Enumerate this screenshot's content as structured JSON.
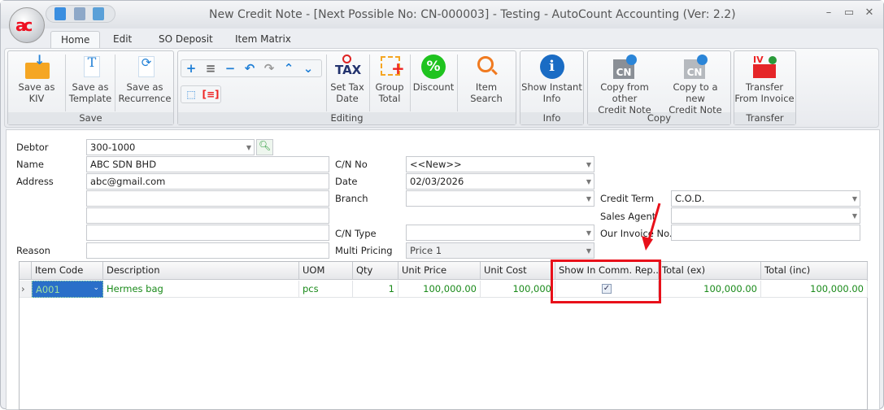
{
  "window": {
    "title": "New Credit Note - [Next Possible No: CN-000003] - Testing - AutoCount Accounting (Ver: 2.2)",
    "logo_text": "ac",
    "controls": [
      "–",
      "▭",
      "✕"
    ]
  },
  "tabs": [
    {
      "label": "Home",
      "active": true
    },
    {
      "label": "Edit"
    },
    {
      "label": "SO Deposit"
    },
    {
      "label": "Item Matrix"
    }
  ],
  "ribbon": {
    "groups": {
      "save": "Save",
      "editing": "Editing",
      "info": "Info",
      "copy": "Copy",
      "transfer": "Transfer"
    },
    "buttons": {
      "save_kiv": [
        "Save as KIV",
        ""
      ],
      "save_template": [
        "Save as",
        "Template"
      ],
      "save_recurrence": [
        "Save as",
        "Recurrence"
      ],
      "set_tax_date": [
        "Set Tax",
        "Date"
      ],
      "group_total": [
        "Group",
        "Total"
      ],
      "discount": [
        "Discount",
        ""
      ],
      "item_search": [
        "Item Search",
        ""
      ],
      "show_instant_info": [
        "Show Instant",
        "Info"
      ],
      "copy_from": [
        "Copy from other",
        "Credit Note"
      ],
      "copy_to": [
        "Copy to a new",
        "Credit Note"
      ],
      "transfer_invoice": [
        "Transfer",
        "From Invoice"
      ]
    },
    "icon_text": {
      "tax": "TAX",
      "cn": "CN",
      "iv": "IV",
      "discount": "%",
      "info": "i"
    }
  },
  "form": {
    "debtor": {
      "label": "Debtor",
      "value": "300-1000"
    },
    "name": {
      "label": "Name",
      "value": "ABC SDN BHD"
    },
    "address": {
      "label": "Address",
      "lines": [
        "abc@gmail.com",
        "",
        "",
        ""
      ]
    },
    "reason": {
      "label": "Reason",
      "value": ""
    },
    "cn_no": {
      "label": "C/N No",
      "value": "<<New>>"
    },
    "date": {
      "label": "Date",
      "value": "02/03/2026"
    },
    "branch": {
      "label": "Branch",
      "value": ""
    },
    "cn_type": {
      "label": "C/N Type",
      "value": ""
    },
    "multi_pricing": {
      "label": "Multi Pricing",
      "value": "Price 1"
    },
    "credit_term": {
      "label": "Credit Term",
      "value": "C.O.D."
    },
    "sales_agent": {
      "label": "Sales Agent",
      "value": ""
    },
    "our_invoice_no": {
      "label": "Our Invoice No.",
      "value": ""
    }
  },
  "grid": {
    "columns": [
      "Item Code",
      "Description",
      "UOM",
      "Qty",
      "Unit Price",
      "Unit Cost",
      "Show In Comm. Rep...",
      "Total (ex)",
      "Total (inc)"
    ],
    "rows": [
      {
        "item_code": "A001",
        "description": "Hermes bag",
        "uom": "pcs",
        "qty": "1",
        "unit_price": "100,000.00",
        "unit_cost": "100,000",
        "show_in_comm": true,
        "total_ex": "100,000.00",
        "total_inc": "100,000.00"
      }
    ]
  },
  "annotation": {
    "color": "#e8101a"
  }
}
